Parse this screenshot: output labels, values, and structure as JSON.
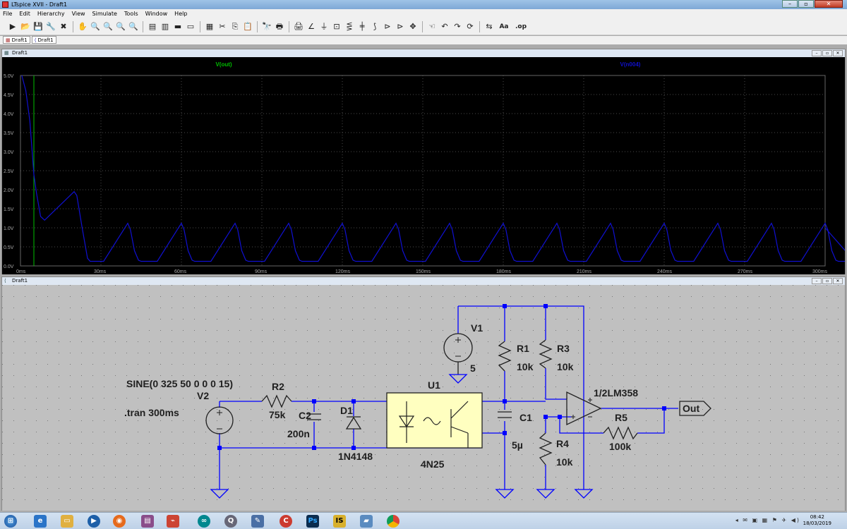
{
  "window": {
    "title": "LTspice XVII - Draft1",
    "min": "–",
    "max": "▫",
    "close": "✕"
  },
  "menu": [
    "File",
    "Edit",
    "Hierarchy",
    "View",
    "Simulate",
    "Tools",
    "Window",
    "Help"
  ],
  "toolbar": {
    "icons": [
      "run-icon",
      "open-icon",
      "save-icon",
      "control-panel-icon",
      "halt-icon",
      "hand-icon",
      "zoom-in-icon",
      "zoom-pan-icon",
      "zoom-out-icon",
      "zoom-cancel-icon",
      "autoscale-icon",
      "zoom-full-icon",
      "tile-horizontal-icon",
      "tile-vertical-icon",
      "cascade-icon",
      "cut-icon",
      "copy-icon",
      "paste-icon",
      "find-icon",
      "print-icon",
      "print-setup-icon",
      "wire-icon",
      "ground-icon",
      "label-icon",
      "resistor-icon",
      "capacitor-icon",
      "inductor-icon",
      "diode-icon",
      "component-icon",
      "move-icon",
      "drag-icon",
      "undo-icon",
      "redo-icon",
      "rotate-icon",
      "mirror-icon",
      "text-icon",
      "spice-directive-icon"
    ],
    "glyphs": [
      "▶",
      "📂",
      "💾",
      "🔧",
      "✖",
      "✋",
      "🔍",
      "🔍",
      "🔍",
      "🔍",
      "▤",
      "▥",
      "▬",
      "▭",
      "▦",
      "✂",
      "⎘",
      "📋",
      "🔭",
      "🖶",
      "🖨",
      "∠",
      "⏚",
      "⊡",
      "⋚",
      "╪",
      "⟆",
      "⊳",
      "⊳",
      "✥",
      "☜",
      "↶",
      "↷",
      "⟳",
      "⇆",
      "Aa",
      ".op"
    ],
    "text_label": "Aa",
    "op_label": ".op"
  },
  "tabs": [
    "Draft1",
    "Draft1"
  ],
  "waveform": {
    "window_title": "Draft1",
    "trace1_name": "V(out)",
    "trace2_name": "V(n004)",
    "y_ticks": [
      "5.0V",
      "4.5V",
      "4.0V",
      "3.5V",
      "3.0V",
      "2.5V",
      "2.0V",
      "1.5V",
      "1.0V",
      "0.5V",
      "0.0V"
    ],
    "x_ticks": [
      "0ms",
      "30ms",
      "60ms",
      "90ms",
      "120ms",
      "150ms",
      "180ms",
      "210ms",
      "240ms",
      "270ms",
      "300ms"
    ],
    "colors": {
      "background": "#000000",
      "trace1": "#00c000",
      "trace2": "#1010d0",
      "grid": "#4a4a4a"
    }
  },
  "schematic": {
    "window_title": "Draft1",
    "labels": {
      "v1": "V1",
      "v1_val": "5",
      "r1": "R1",
      "r1_val": "10k",
      "r3": "R3",
      "r3_val": "10k",
      "u1": "U1",
      "u1_val": "4N25",
      "opamp": "1/2LM358",
      "out": "Out",
      "r5": "R5",
      "r5_val": "100k",
      "c1": "C1",
      "c1_val": "5µ",
      "r4": "R4",
      "r4_val": "10k",
      "sine": "SINE(0 325 50 0 0 0 15)",
      "v2": "V2",
      "tran": ".tran 300ms",
      "r2": "R2",
      "r2_val": "75k",
      "c2": "C2",
      "c2_val": "200n",
      "d1": "D1",
      "d1_val": "1N4148"
    },
    "colors": {
      "background": "#c0c0c0",
      "wire": "#0000ff",
      "component": "#202020",
      "junction": "#0000ff",
      "optocoupler_fill": "#ffffc0"
    }
  },
  "taskbar": {
    "icons": [
      "start-icon",
      "ie-icon",
      "explorer-icon",
      "media-player-icon",
      "firefox-icon",
      "winrar-icon",
      "ltspice-icon",
      "arduino-icon",
      "magnifier-icon",
      "notepad-icon",
      "ccleaner-icon",
      "photoshop-icon",
      "isis-icon",
      "pinned-app-icon",
      "chrome-icon"
    ],
    "clock_time": "08:42",
    "clock_date": "18/03/2019"
  }
}
